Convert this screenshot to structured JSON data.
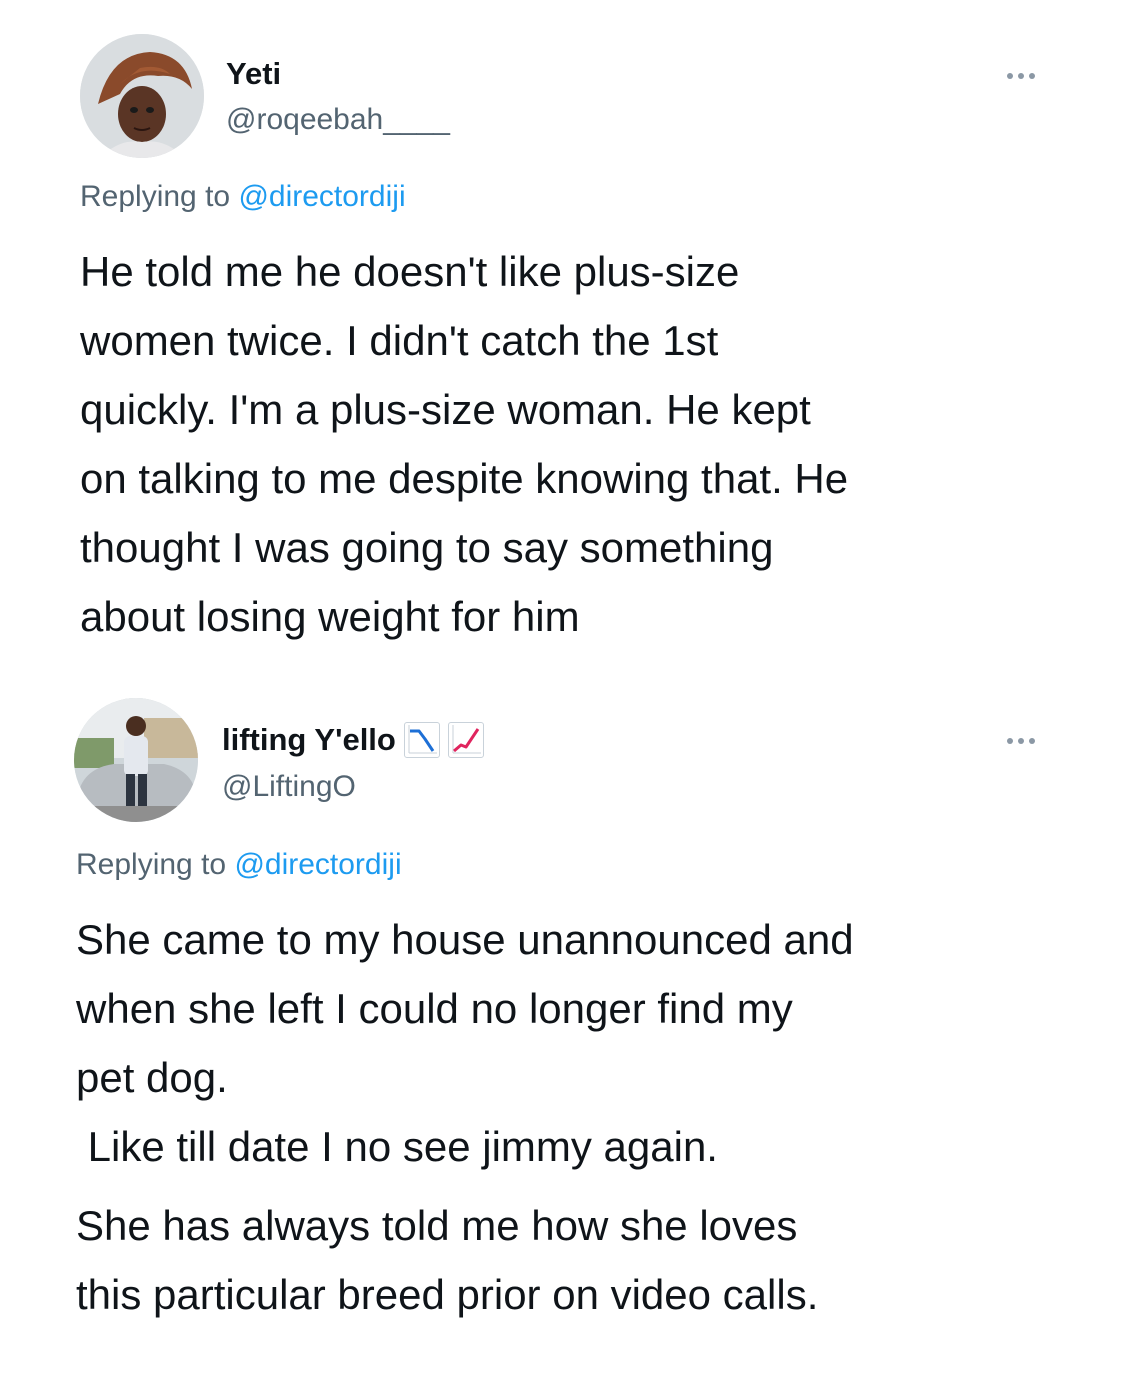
{
  "tweets": [
    {
      "display_name": "Yeti",
      "handle": "@roqeebah____",
      "replying_prefix": "Replying to",
      "replying_to": "@directordiji",
      "body_lines": [
        "He told me he doesn't like plus-size",
        "women twice. I didn't catch the 1st",
        "quickly. I'm a plus-size woman. He kept",
        "on talking to me despite knowing that. He",
        "thought I was going to say something",
        "about losing weight for him"
      ],
      "icons": [
        "avatar",
        "more-options-icon"
      ]
    },
    {
      "display_name": "lifting Y'ello",
      "name_emojis": [
        "chart-decreasing-icon",
        "chart-increasing-icon"
      ],
      "handle": "@LiftingO",
      "replying_prefix": "Replying to",
      "replying_to": "@directordiji",
      "body_lines": [
        "She came to my house unannounced and",
        "when she left I could no longer find my",
        "pet dog.",
        " Like till date I no see jimmy again.",
        "She has always told me how she loves",
        "this particular breed prior on video calls."
      ],
      "icons": [
        "avatar",
        "more-options-icon"
      ],
      "colors": {
        "chart_down": "#1d6fd6",
        "chart_up": "#e0245e"
      }
    }
  ]
}
